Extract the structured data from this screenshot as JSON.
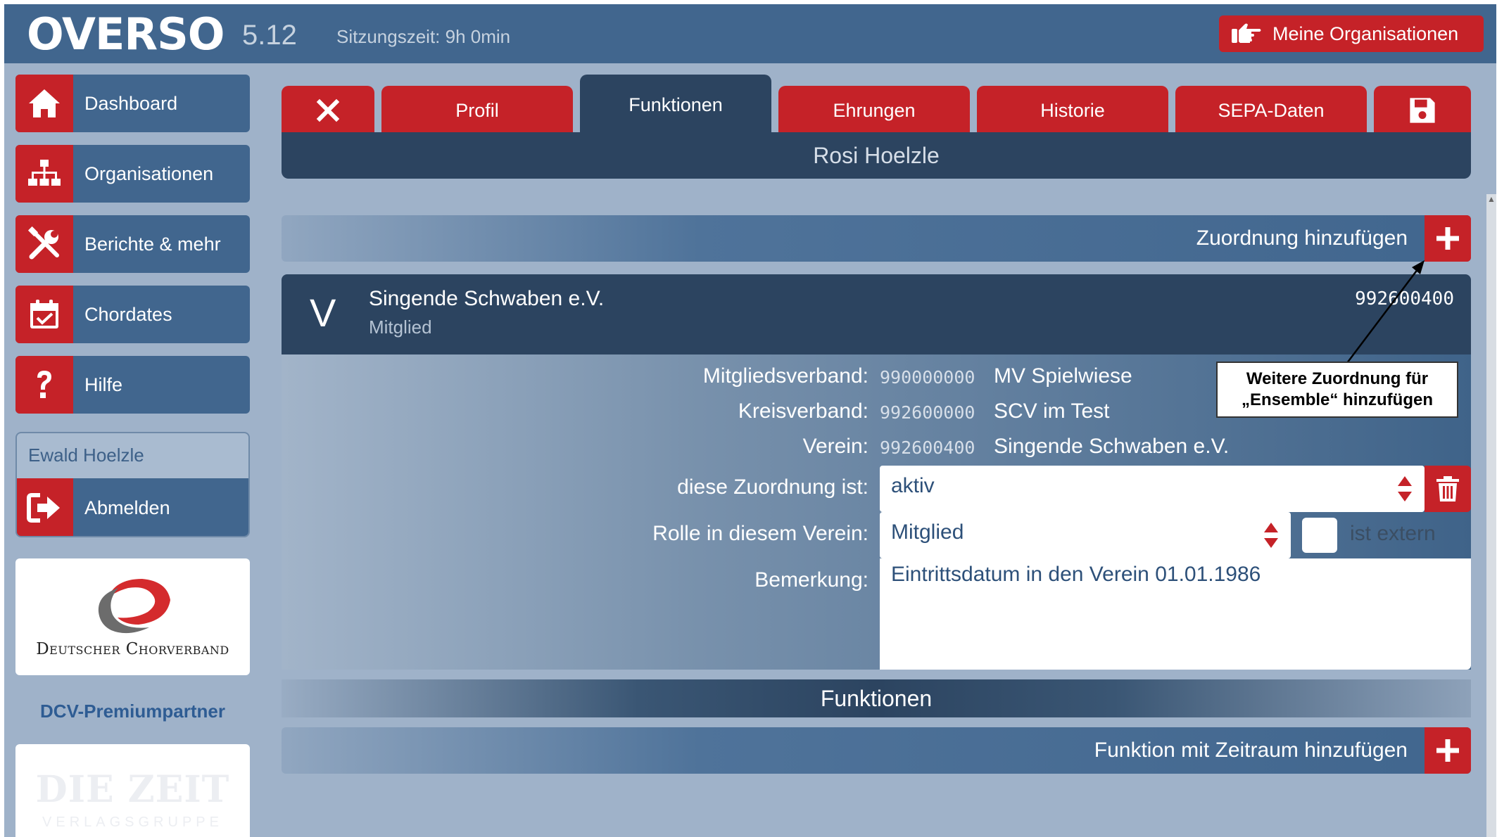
{
  "app": {
    "logo": "OVERSO",
    "version": "5.12",
    "session": "Sitzungszeit: 9h 0min",
    "my_orgs_label": "Meine Organisationen"
  },
  "sidebar": {
    "items": [
      {
        "label": "Dashboard",
        "icon": "home-icon"
      },
      {
        "label": "Organisationen",
        "icon": "org-chart-icon"
      },
      {
        "label": "Berichte & mehr",
        "icon": "tools-icon"
      },
      {
        "label": "Chordates",
        "icon": "calendar-check-icon"
      },
      {
        "label": "Hilfe",
        "icon": "question-icon"
      }
    ],
    "user_name": "Ewald Hoelzle",
    "logout_label": "Abmelden",
    "partner_logo_text": "Deutscher Chorverband",
    "partner_caption": "DCV-Premiumpartner",
    "sponsor_logo_text": "DIE ZEIT",
    "sponsor_logo_sub": "VERLAGSGRUPPE"
  },
  "tabs": {
    "close_icon": "close-icon",
    "items": [
      {
        "label": "Profil"
      },
      {
        "label": "Funktionen"
      },
      {
        "label": "Ehrungen"
      },
      {
        "label": "Historie"
      },
      {
        "label": "SEPA-Daten"
      }
    ],
    "active": "Funktionen",
    "save_icon": "save-icon"
  },
  "person": {
    "name": "Rosi Hoelzle"
  },
  "assignment": {
    "add_label": "Zuordnung hinzufügen",
    "org_letter": "V",
    "org_name": "Singende Schwaben e.V.",
    "org_role": "Mitglied",
    "org_number": "992600400",
    "hierarchy": [
      {
        "label": "Mitgliedsverband:",
        "number": "990000000",
        "name": "MV Spielwiese"
      },
      {
        "label": "Kreisverband:",
        "number": "992600000",
        "name": "SCV im Test"
      },
      {
        "label": "Verein:",
        "number": "992600400",
        "name": "Singende Schwaben e.V."
      }
    ],
    "status_label": "diese Zuordnung ist:",
    "status_value": "aktiv",
    "role_label": "Rolle in diesem Verein:",
    "role_value": "Mitglied",
    "extern_label": "ist extern",
    "extern_checked": false,
    "remark_label": "Bemerkung:",
    "remark_value": "Eintrittsdatum in den Verein 01.01.1986"
  },
  "functions": {
    "heading": "Funktionen",
    "add_label": "Funktion mit Zeitraum hinzufügen"
  },
  "annotation": {
    "text_line1": "Weitere Zuordnung für",
    "text_line2": "„Ensemble“ hinzufügen"
  },
  "colors": {
    "primary_red": "#c52228",
    "nav_blue": "#41668e",
    "dark_blue": "#2c4460",
    "background": "#9fb2c9"
  }
}
